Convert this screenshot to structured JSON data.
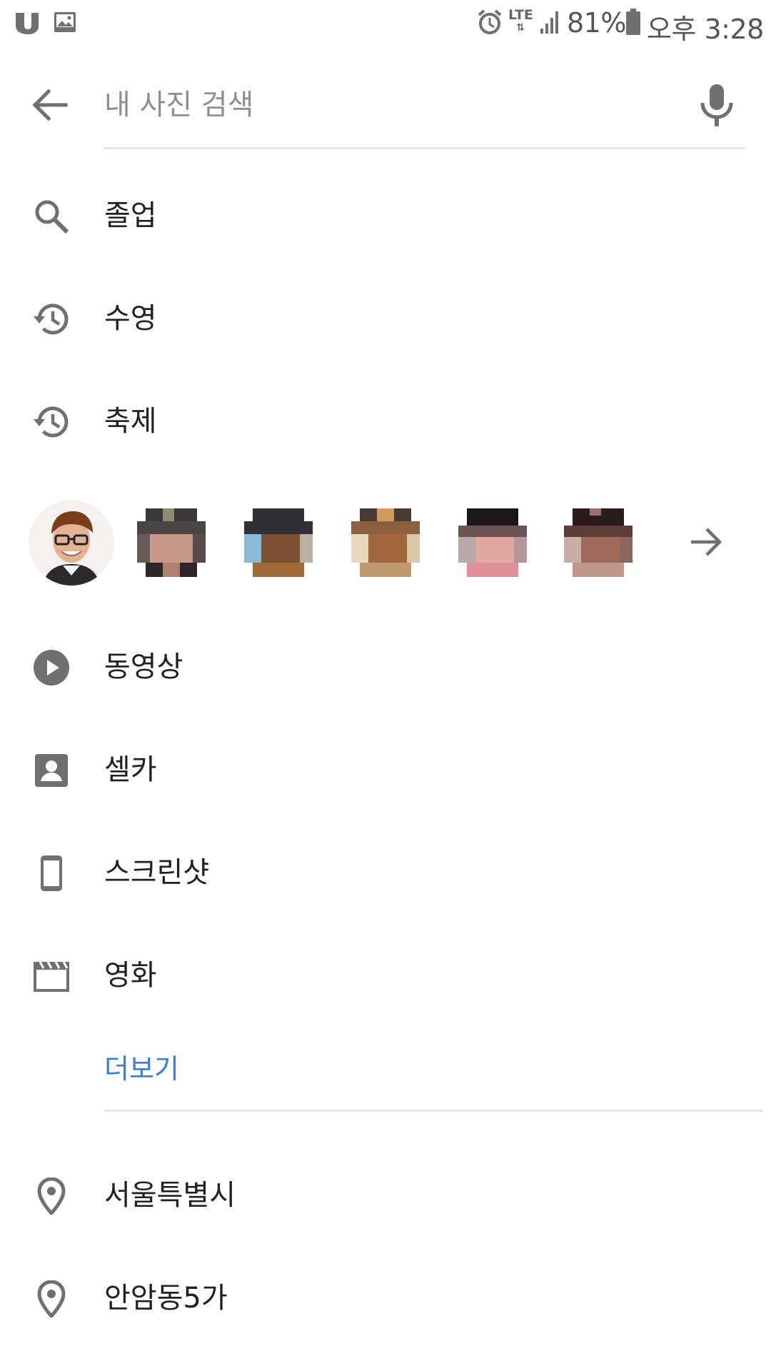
{
  "status_bar": {
    "network": "LTE",
    "battery": "81%",
    "time": "오후 3:28"
  },
  "search": {
    "placeholder": "내 사진 검색",
    "value": ""
  },
  "suggestions": [
    {
      "icon": "search-icon",
      "label": "졸업"
    },
    {
      "icon": "history-icon",
      "label": "수영"
    },
    {
      "icon": "history-icon",
      "label": "축제"
    }
  ],
  "people": {
    "count": 6,
    "more_icon": "arrow-forward-icon"
  },
  "categories": [
    {
      "icon": "play-circle-icon",
      "label": "동영상"
    },
    {
      "icon": "selfie-icon",
      "label": "셀카"
    },
    {
      "icon": "phone-screenshot-icon",
      "label": "스크린샷"
    },
    {
      "icon": "movie-clapper-icon",
      "label": "영화"
    }
  ],
  "more_label": "더보기",
  "places": [
    {
      "icon": "location-pin-icon",
      "label": "서울특별시"
    },
    {
      "icon": "location-pin-icon",
      "label": "안암동5가"
    }
  ],
  "colors": {
    "icon_gray": "#707070",
    "link_blue": "#3b7ddd",
    "divider": "#e6e6e6"
  }
}
